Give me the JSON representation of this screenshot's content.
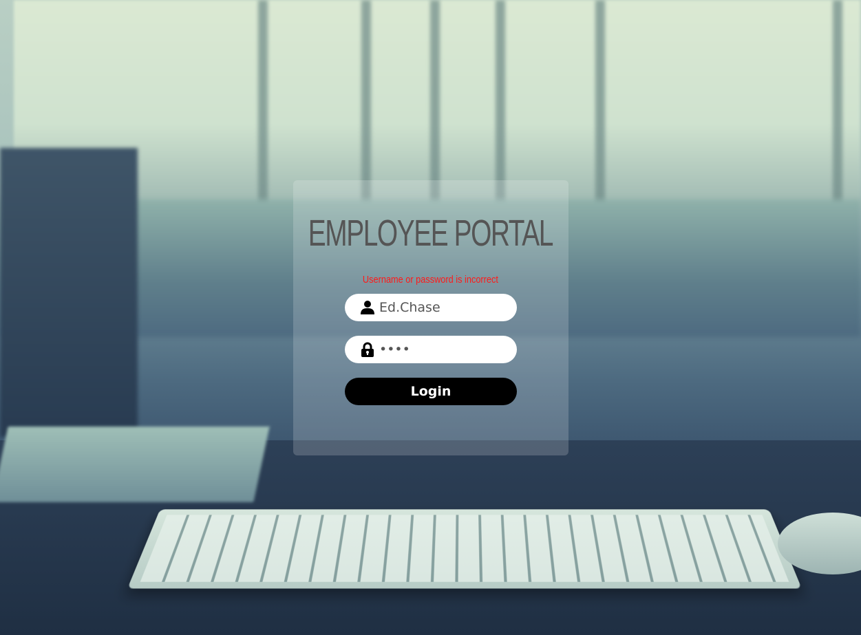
{
  "login": {
    "title": "EMPLOYEE PORTAL",
    "error_message": "Username or password is incorrect",
    "username_value": "Ed.Chase",
    "password_value": "••••",
    "login_button_label": "Login"
  },
  "icons": {
    "username": "user-icon",
    "password": "lock-icon"
  },
  "colors": {
    "error": "#ff1a1a",
    "button_bg": "#000000",
    "button_text": "#ffffff",
    "title": "#555555"
  }
}
